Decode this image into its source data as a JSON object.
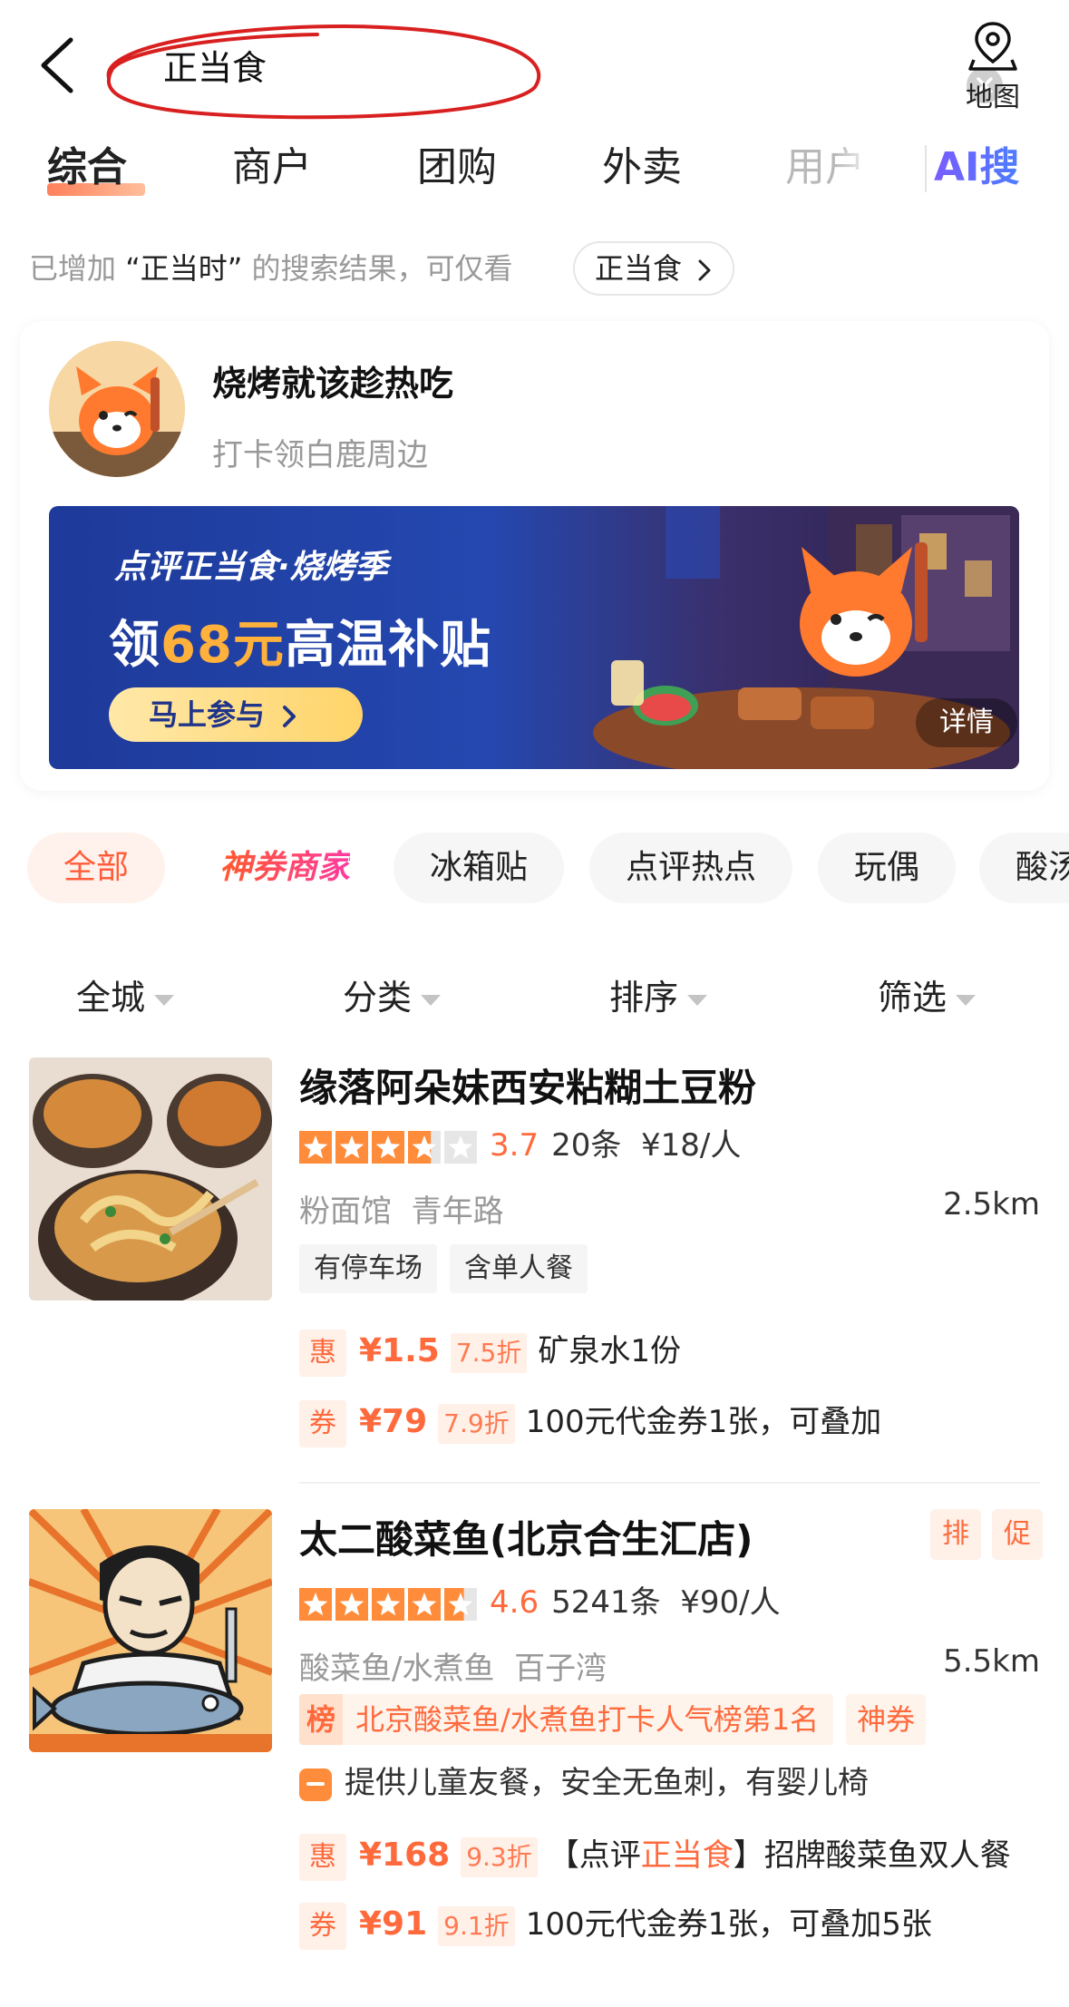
{
  "search": {
    "query": "正当食",
    "map_label": "地图"
  },
  "tabs": [
    {
      "label": "综合",
      "active": true
    },
    {
      "label": "商户"
    },
    {
      "label": "团购"
    },
    {
      "label": "外卖"
    },
    {
      "label": "用户"
    }
  ],
  "ai_tab": "AI搜",
  "notice": {
    "prefix": "已增加",
    "quoted": "“正当时”",
    "suffix": "的搜索结果，可仅看",
    "only_chip": "正当食"
  },
  "promo": {
    "title": "烧烤就该趁热吃",
    "subtitle": "打卡领白鹿周边",
    "banner": {
      "tag": "点评正当食·烧烤季",
      "headline_prefix": "领",
      "headline_amount": "68元",
      "headline_suffix": "高温补贴",
      "cta": "马上参与",
      "detail": "详情"
    }
  },
  "chips": [
    "全部",
    "神券商家",
    "冰箱贴",
    "点评热点",
    "玩偶",
    "酸汤"
  ],
  "filters": [
    "全城",
    "分类",
    "排序",
    "筛选"
  ],
  "shops": [
    {
      "name": "缘落阿朵妹西安粘糊土豆粉",
      "rating": 3.7,
      "score": "3.7",
      "reviews": "20条",
      "price": "¥18/人",
      "category": "粉面馆",
      "area": "青年路",
      "distance": "2.5km",
      "tags": [
        "有停车场",
        "含单人餐"
      ],
      "deals": [
        {
          "badge": "惠",
          "price": "¥1.5",
          "discount": "7.5折",
          "text": "矿泉水1份"
        },
        {
          "badge": "券",
          "price": "¥79",
          "discount": "7.9折",
          "text": "100元代金券1张，可叠加"
        }
      ]
    },
    {
      "name": "太二酸菜鱼(北京合生汇店)",
      "side_badges": [
        "排",
        "促"
      ],
      "rating": 4.6,
      "score": "4.6",
      "reviews": "5241条",
      "price": "¥90/人",
      "category": "酸菜鱼/水煮鱼",
      "area": "百子湾",
      "distance": "5.5km",
      "rank": {
        "icon": "榜",
        "text": "北京酸菜鱼/水煮鱼打卡人气榜第1名",
        "chip": "神券"
      },
      "feature": "提供儿童友餐，安全无鱼刺，有婴儿椅",
      "deals": [
        {
          "badge": "惠",
          "price": "¥168",
          "discount": "9.3折",
          "text_prefix": "【点评",
          "text_highlight": "正当食",
          "text_suffix": "】招牌酸菜鱼双人餐"
        },
        {
          "badge": "券",
          "price": "¥91",
          "discount": "9.1折",
          "text": "100元代金券1张，可叠加5张"
        }
      ]
    }
  ],
  "colors": {
    "accent": "#ff6a3d",
    "ai_purple": "#5b5cf0",
    "banner_blue": "#2448b0"
  }
}
